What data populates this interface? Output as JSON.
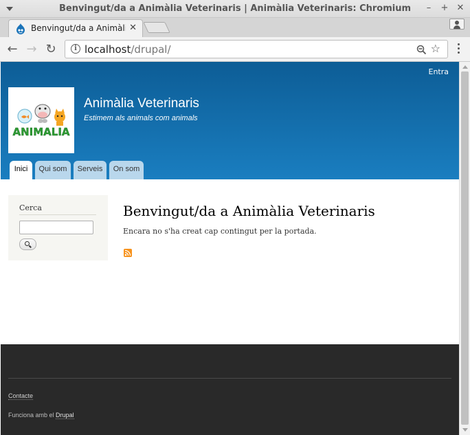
{
  "window": {
    "title": "Benvingut/da a Animàlia Veterinaris | Animàlia Veterinaris: Chromium"
  },
  "tab": {
    "title": "Benvingut/da a Animàli",
    "close_glyph": "✕"
  },
  "toolbar": {
    "url_host": "localhost",
    "url_path": "/drupal/"
  },
  "header": {
    "login_link": "Entra",
    "site_name": "Animàlia Veterinaris",
    "slogan": "Estimem als animals com animals",
    "logo_text": "ANIMALIA",
    "menu": [
      {
        "label": "Inici",
        "active": true
      },
      {
        "label": "Qui som",
        "active": false
      },
      {
        "label": "Serveis",
        "active": false
      },
      {
        "label": "On som",
        "active": false
      }
    ]
  },
  "sidebar": {
    "block_title": "Cerca",
    "search_placeholder": ""
  },
  "main": {
    "page_title": "Benvingut/da a Animàlia Veterinaris",
    "text": "Encara no s'ha creat cap contingut per la portada."
  },
  "footer": {
    "contact_link": "Contacte",
    "powered_prefix": "Funciona amb el ",
    "powered_link": "Drupal"
  },
  "colors": {
    "header_top": "#0d5d96",
    "header_bottom": "#1a7ec0",
    "menu_tab": "#b9d7ec",
    "footer_bg": "#292929",
    "feed_icon": "#f7931e"
  }
}
